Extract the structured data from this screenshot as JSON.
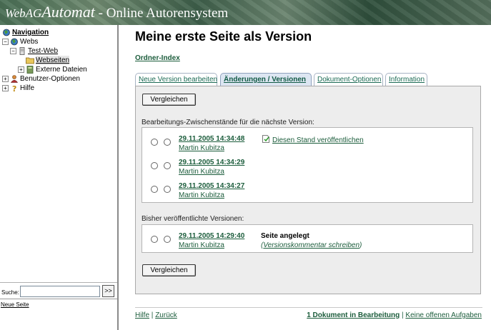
{
  "header": {
    "brand_small": "WebAG",
    "brand_big": "Automat",
    "subtitle": " - Online Autorensystem"
  },
  "sidebar": {
    "navigation": "Navigation",
    "webs": "Webs",
    "test_web": "Test-Web",
    "webseiten": "Webseiten",
    "externe_dateien": "Externe Dateien",
    "benutzer_optionen": "Benutzer-Optionen",
    "hilfe": "Hilfe",
    "search_label": "Suche:",
    "search_value": "",
    "search_button": ">>",
    "neue_seite": "Neue Seite"
  },
  "main": {
    "title": "Meine erste Seite als Version",
    "ordner_index": "Ordner-Index",
    "tabs": [
      {
        "label": "Neue Version bearbeiten"
      },
      {
        "label": "Änderungen / Versionen"
      },
      {
        "label": "Dokument-Optionen"
      },
      {
        "label": "Information"
      }
    ],
    "compare_button": "Vergleichen",
    "drafts_label": "Bearbeitungs-Zwischenstände für die nächste Version:",
    "publish_link": "Diesen Stand veröffentlichen",
    "drafts": [
      {
        "date": "29.11.2005 14:34:48",
        "author": "Martin Kubitza"
      },
      {
        "date": "29.11.2005 14:34:29",
        "author": "Martin Kubitza"
      },
      {
        "date": "29.11.2005 14:34:27",
        "author": "Martin Kubitza"
      }
    ],
    "published_label": "Bisher veröffentlichte Versionen:",
    "published": [
      {
        "date": "29.11.2005 14:29:40",
        "author": "Martin Kubitza",
        "status": "Seite angelegt",
        "comment_open": "(",
        "comment_link": "Versionskommentar schreiben",
        "comment_close": ")"
      }
    ]
  },
  "footer": {
    "hilfe": "Hilfe",
    "sep": "|",
    "zurueck": "Zurück",
    "docs_in_edit": "1 Dokument in Bearbeitung",
    "sep2": "|",
    "no_tasks": "Keine offenen Aufgaben"
  },
  "colors": {
    "link_green": "#1c5d3c",
    "panel_bg": "#ededed",
    "active_tab_bg": "#dde6f2"
  }
}
